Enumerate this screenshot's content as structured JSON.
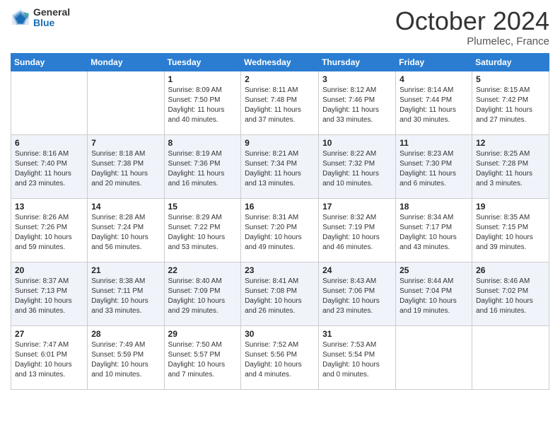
{
  "header": {
    "logo_general": "General",
    "logo_blue": "Blue",
    "month": "October 2024",
    "location": "Plumelec, France"
  },
  "days_of_week": [
    "Sunday",
    "Monday",
    "Tuesday",
    "Wednesday",
    "Thursday",
    "Friday",
    "Saturday"
  ],
  "weeks": [
    [
      {
        "day": "",
        "sunrise": "",
        "sunset": "",
        "daylight": ""
      },
      {
        "day": "",
        "sunrise": "",
        "sunset": "",
        "daylight": ""
      },
      {
        "day": "1",
        "sunrise": "Sunrise: 8:09 AM",
        "sunset": "Sunset: 7:50 PM",
        "daylight": "Daylight: 11 hours and 40 minutes."
      },
      {
        "day": "2",
        "sunrise": "Sunrise: 8:11 AM",
        "sunset": "Sunset: 7:48 PM",
        "daylight": "Daylight: 11 hours and 37 minutes."
      },
      {
        "day": "3",
        "sunrise": "Sunrise: 8:12 AM",
        "sunset": "Sunset: 7:46 PM",
        "daylight": "Daylight: 11 hours and 33 minutes."
      },
      {
        "day": "4",
        "sunrise": "Sunrise: 8:14 AM",
        "sunset": "Sunset: 7:44 PM",
        "daylight": "Daylight: 11 hours and 30 minutes."
      },
      {
        "day": "5",
        "sunrise": "Sunrise: 8:15 AM",
        "sunset": "Sunset: 7:42 PM",
        "daylight": "Daylight: 11 hours and 27 minutes."
      }
    ],
    [
      {
        "day": "6",
        "sunrise": "Sunrise: 8:16 AM",
        "sunset": "Sunset: 7:40 PM",
        "daylight": "Daylight: 11 hours and 23 minutes."
      },
      {
        "day": "7",
        "sunrise": "Sunrise: 8:18 AM",
        "sunset": "Sunset: 7:38 PM",
        "daylight": "Daylight: 11 hours and 20 minutes."
      },
      {
        "day": "8",
        "sunrise": "Sunrise: 8:19 AM",
        "sunset": "Sunset: 7:36 PM",
        "daylight": "Daylight: 11 hours and 16 minutes."
      },
      {
        "day": "9",
        "sunrise": "Sunrise: 8:21 AM",
        "sunset": "Sunset: 7:34 PM",
        "daylight": "Daylight: 11 hours and 13 minutes."
      },
      {
        "day": "10",
        "sunrise": "Sunrise: 8:22 AM",
        "sunset": "Sunset: 7:32 PM",
        "daylight": "Daylight: 11 hours and 10 minutes."
      },
      {
        "day": "11",
        "sunrise": "Sunrise: 8:23 AM",
        "sunset": "Sunset: 7:30 PM",
        "daylight": "Daylight: 11 hours and 6 minutes."
      },
      {
        "day": "12",
        "sunrise": "Sunrise: 8:25 AM",
        "sunset": "Sunset: 7:28 PM",
        "daylight": "Daylight: 11 hours and 3 minutes."
      }
    ],
    [
      {
        "day": "13",
        "sunrise": "Sunrise: 8:26 AM",
        "sunset": "Sunset: 7:26 PM",
        "daylight": "Daylight: 10 hours and 59 minutes."
      },
      {
        "day": "14",
        "sunrise": "Sunrise: 8:28 AM",
        "sunset": "Sunset: 7:24 PM",
        "daylight": "Daylight: 10 hours and 56 minutes."
      },
      {
        "day": "15",
        "sunrise": "Sunrise: 8:29 AM",
        "sunset": "Sunset: 7:22 PM",
        "daylight": "Daylight: 10 hours and 53 minutes."
      },
      {
        "day": "16",
        "sunrise": "Sunrise: 8:31 AM",
        "sunset": "Sunset: 7:20 PM",
        "daylight": "Daylight: 10 hours and 49 minutes."
      },
      {
        "day": "17",
        "sunrise": "Sunrise: 8:32 AM",
        "sunset": "Sunset: 7:19 PM",
        "daylight": "Daylight: 10 hours and 46 minutes."
      },
      {
        "day": "18",
        "sunrise": "Sunrise: 8:34 AM",
        "sunset": "Sunset: 7:17 PM",
        "daylight": "Daylight: 10 hours and 43 minutes."
      },
      {
        "day": "19",
        "sunrise": "Sunrise: 8:35 AM",
        "sunset": "Sunset: 7:15 PM",
        "daylight": "Daylight: 10 hours and 39 minutes."
      }
    ],
    [
      {
        "day": "20",
        "sunrise": "Sunrise: 8:37 AM",
        "sunset": "Sunset: 7:13 PM",
        "daylight": "Daylight: 10 hours and 36 minutes."
      },
      {
        "day": "21",
        "sunrise": "Sunrise: 8:38 AM",
        "sunset": "Sunset: 7:11 PM",
        "daylight": "Daylight: 10 hours and 33 minutes."
      },
      {
        "day": "22",
        "sunrise": "Sunrise: 8:40 AM",
        "sunset": "Sunset: 7:09 PM",
        "daylight": "Daylight: 10 hours and 29 minutes."
      },
      {
        "day": "23",
        "sunrise": "Sunrise: 8:41 AM",
        "sunset": "Sunset: 7:08 PM",
        "daylight": "Daylight: 10 hours and 26 minutes."
      },
      {
        "day": "24",
        "sunrise": "Sunrise: 8:43 AM",
        "sunset": "Sunset: 7:06 PM",
        "daylight": "Daylight: 10 hours and 23 minutes."
      },
      {
        "day": "25",
        "sunrise": "Sunrise: 8:44 AM",
        "sunset": "Sunset: 7:04 PM",
        "daylight": "Daylight: 10 hours and 19 minutes."
      },
      {
        "day": "26",
        "sunrise": "Sunrise: 8:46 AM",
        "sunset": "Sunset: 7:02 PM",
        "daylight": "Daylight: 10 hours and 16 minutes."
      }
    ],
    [
      {
        "day": "27",
        "sunrise": "Sunrise: 7:47 AM",
        "sunset": "Sunset: 6:01 PM",
        "daylight": "Daylight: 10 hours and 13 minutes."
      },
      {
        "day": "28",
        "sunrise": "Sunrise: 7:49 AM",
        "sunset": "Sunset: 5:59 PM",
        "daylight": "Daylight: 10 hours and 10 minutes."
      },
      {
        "day": "29",
        "sunrise": "Sunrise: 7:50 AM",
        "sunset": "Sunset: 5:57 PM",
        "daylight": "Daylight: 10 hours and 7 minutes."
      },
      {
        "day": "30",
        "sunrise": "Sunrise: 7:52 AM",
        "sunset": "Sunset: 5:56 PM",
        "daylight": "Daylight: 10 hours and 4 minutes."
      },
      {
        "day": "31",
        "sunrise": "Sunrise: 7:53 AM",
        "sunset": "Sunset: 5:54 PM",
        "daylight": "Daylight: 10 hours and 0 minutes."
      },
      {
        "day": "",
        "sunrise": "",
        "sunset": "",
        "daylight": ""
      },
      {
        "day": "",
        "sunrise": "",
        "sunset": "",
        "daylight": ""
      }
    ]
  ]
}
